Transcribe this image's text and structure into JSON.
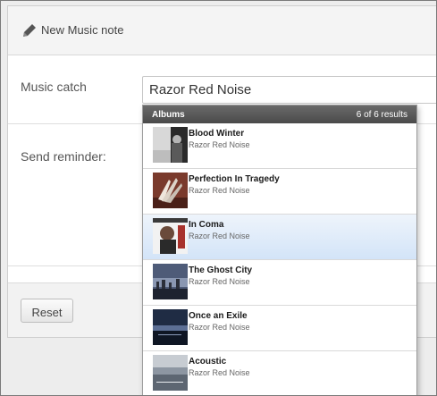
{
  "panel": {
    "title": "New Music note"
  },
  "form": {
    "music_catch_label": "Music catch",
    "music_catch_value": "Razor Red Noise",
    "send_reminder_label": "Send reminder:"
  },
  "footer": {
    "reset_label": "Reset"
  },
  "dropdown": {
    "header": "Albums",
    "count": "6 of 6 results",
    "albums": [
      {
        "title": "Blood Winter",
        "artist": "Razor Red Noise"
      },
      {
        "title": "Perfection In Tragedy",
        "artist": "Razor Red Noise"
      },
      {
        "title": "In Coma",
        "artist": "Razor Red Noise"
      },
      {
        "title": "The Ghost City",
        "artist": "Razor Red Noise"
      },
      {
        "title": "Once an Exile",
        "artist": "Razor Red Noise"
      },
      {
        "title": "Acoustic",
        "artist": "Razor Red Noise"
      }
    ],
    "active_album": "In Coma"
  },
  "colors": {
    "header_bar": "#555555",
    "active_row": "#d3e4f8"
  },
  "icons": {
    "title_icon": "pencil-icon"
  }
}
